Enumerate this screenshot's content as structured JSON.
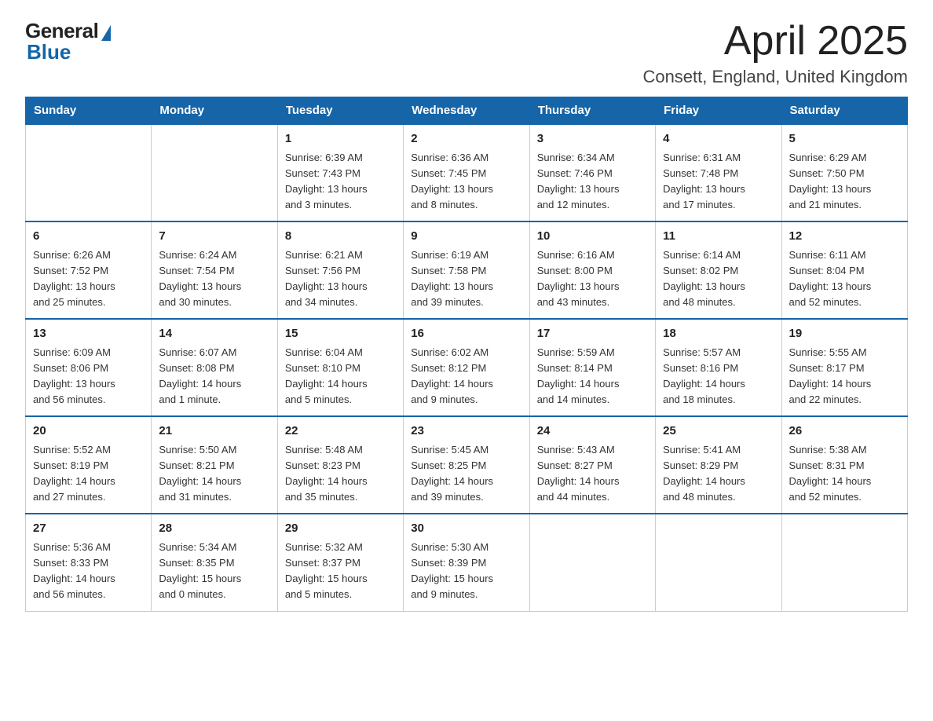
{
  "logo": {
    "general": "General",
    "blue": "Blue"
  },
  "title": "April 2025",
  "subtitle": "Consett, England, United Kingdom",
  "headers": [
    "Sunday",
    "Monday",
    "Tuesday",
    "Wednesday",
    "Thursday",
    "Friday",
    "Saturday"
  ],
  "weeks": [
    [
      {
        "day": "",
        "info": ""
      },
      {
        "day": "",
        "info": ""
      },
      {
        "day": "1",
        "info": "Sunrise: 6:39 AM\nSunset: 7:43 PM\nDaylight: 13 hours\nand 3 minutes."
      },
      {
        "day": "2",
        "info": "Sunrise: 6:36 AM\nSunset: 7:45 PM\nDaylight: 13 hours\nand 8 minutes."
      },
      {
        "day": "3",
        "info": "Sunrise: 6:34 AM\nSunset: 7:46 PM\nDaylight: 13 hours\nand 12 minutes."
      },
      {
        "day": "4",
        "info": "Sunrise: 6:31 AM\nSunset: 7:48 PM\nDaylight: 13 hours\nand 17 minutes."
      },
      {
        "day": "5",
        "info": "Sunrise: 6:29 AM\nSunset: 7:50 PM\nDaylight: 13 hours\nand 21 minutes."
      }
    ],
    [
      {
        "day": "6",
        "info": "Sunrise: 6:26 AM\nSunset: 7:52 PM\nDaylight: 13 hours\nand 25 minutes."
      },
      {
        "day": "7",
        "info": "Sunrise: 6:24 AM\nSunset: 7:54 PM\nDaylight: 13 hours\nand 30 minutes."
      },
      {
        "day": "8",
        "info": "Sunrise: 6:21 AM\nSunset: 7:56 PM\nDaylight: 13 hours\nand 34 minutes."
      },
      {
        "day": "9",
        "info": "Sunrise: 6:19 AM\nSunset: 7:58 PM\nDaylight: 13 hours\nand 39 minutes."
      },
      {
        "day": "10",
        "info": "Sunrise: 6:16 AM\nSunset: 8:00 PM\nDaylight: 13 hours\nand 43 minutes."
      },
      {
        "day": "11",
        "info": "Sunrise: 6:14 AM\nSunset: 8:02 PM\nDaylight: 13 hours\nand 48 minutes."
      },
      {
        "day": "12",
        "info": "Sunrise: 6:11 AM\nSunset: 8:04 PM\nDaylight: 13 hours\nand 52 minutes."
      }
    ],
    [
      {
        "day": "13",
        "info": "Sunrise: 6:09 AM\nSunset: 8:06 PM\nDaylight: 13 hours\nand 56 minutes."
      },
      {
        "day": "14",
        "info": "Sunrise: 6:07 AM\nSunset: 8:08 PM\nDaylight: 14 hours\nand 1 minute."
      },
      {
        "day": "15",
        "info": "Sunrise: 6:04 AM\nSunset: 8:10 PM\nDaylight: 14 hours\nand 5 minutes."
      },
      {
        "day": "16",
        "info": "Sunrise: 6:02 AM\nSunset: 8:12 PM\nDaylight: 14 hours\nand 9 minutes."
      },
      {
        "day": "17",
        "info": "Sunrise: 5:59 AM\nSunset: 8:14 PM\nDaylight: 14 hours\nand 14 minutes."
      },
      {
        "day": "18",
        "info": "Sunrise: 5:57 AM\nSunset: 8:16 PM\nDaylight: 14 hours\nand 18 minutes."
      },
      {
        "day": "19",
        "info": "Sunrise: 5:55 AM\nSunset: 8:17 PM\nDaylight: 14 hours\nand 22 minutes."
      }
    ],
    [
      {
        "day": "20",
        "info": "Sunrise: 5:52 AM\nSunset: 8:19 PM\nDaylight: 14 hours\nand 27 minutes."
      },
      {
        "day": "21",
        "info": "Sunrise: 5:50 AM\nSunset: 8:21 PM\nDaylight: 14 hours\nand 31 minutes."
      },
      {
        "day": "22",
        "info": "Sunrise: 5:48 AM\nSunset: 8:23 PM\nDaylight: 14 hours\nand 35 minutes."
      },
      {
        "day": "23",
        "info": "Sunrise: 5:45 AM\nSunset: 8:25 PM\nDaylight: 14 hours\nand 39 minutes."
      },
      {
        "day": "24",
        "info": "Sunrise: 5:43 AM\nSunset: 8:27 PM\nDaylight: 14 hours\nand 44 minutes."
      },
      {
        "day": "25",
        "info": "Sunrise: 5:41 AM\nSunset: 8:29 PM\nDaylight: 14 hours\nand 48 minutes."
      },
      {
        "day": "26",
        "info": "Sunrise: 5:38 AM\nSunset: 8:31 PM\nDaylight: 14 hours\nand 52 minutes."
      }
    ],
    [
      {
        "day": "27",
        "info": "Sunrise: 5:36 AM\nSunset: 8:33 PM\nDaylight: 14 hours\nand 56 minutes."
      },
      {
        "day": "28",
        "info": "Sunrise: 5:34 AM\nSunset: 8:35 PM\nDaylight: 15 hours\nand 0 minutes."
      },
      {
        "day": "29",
        "info": "Sunrise: 5:32 AM\nSunset: 8:37 PM\nDaylight: 15 hours\nand 5 minutes."
      },
      {
        "day": "30",
        "info": "Sunrise: 5:30 AM\nSunset: 8:39 PM\nDaylight: 15 hours\nand 9 minutes."
      },
      {
        "day": "",
        "info": ""
      },
      {
        "day": "",
        "info": ""
      },
      {
        "day": "",
        "info": ""
      }
    ]
  ]
}
